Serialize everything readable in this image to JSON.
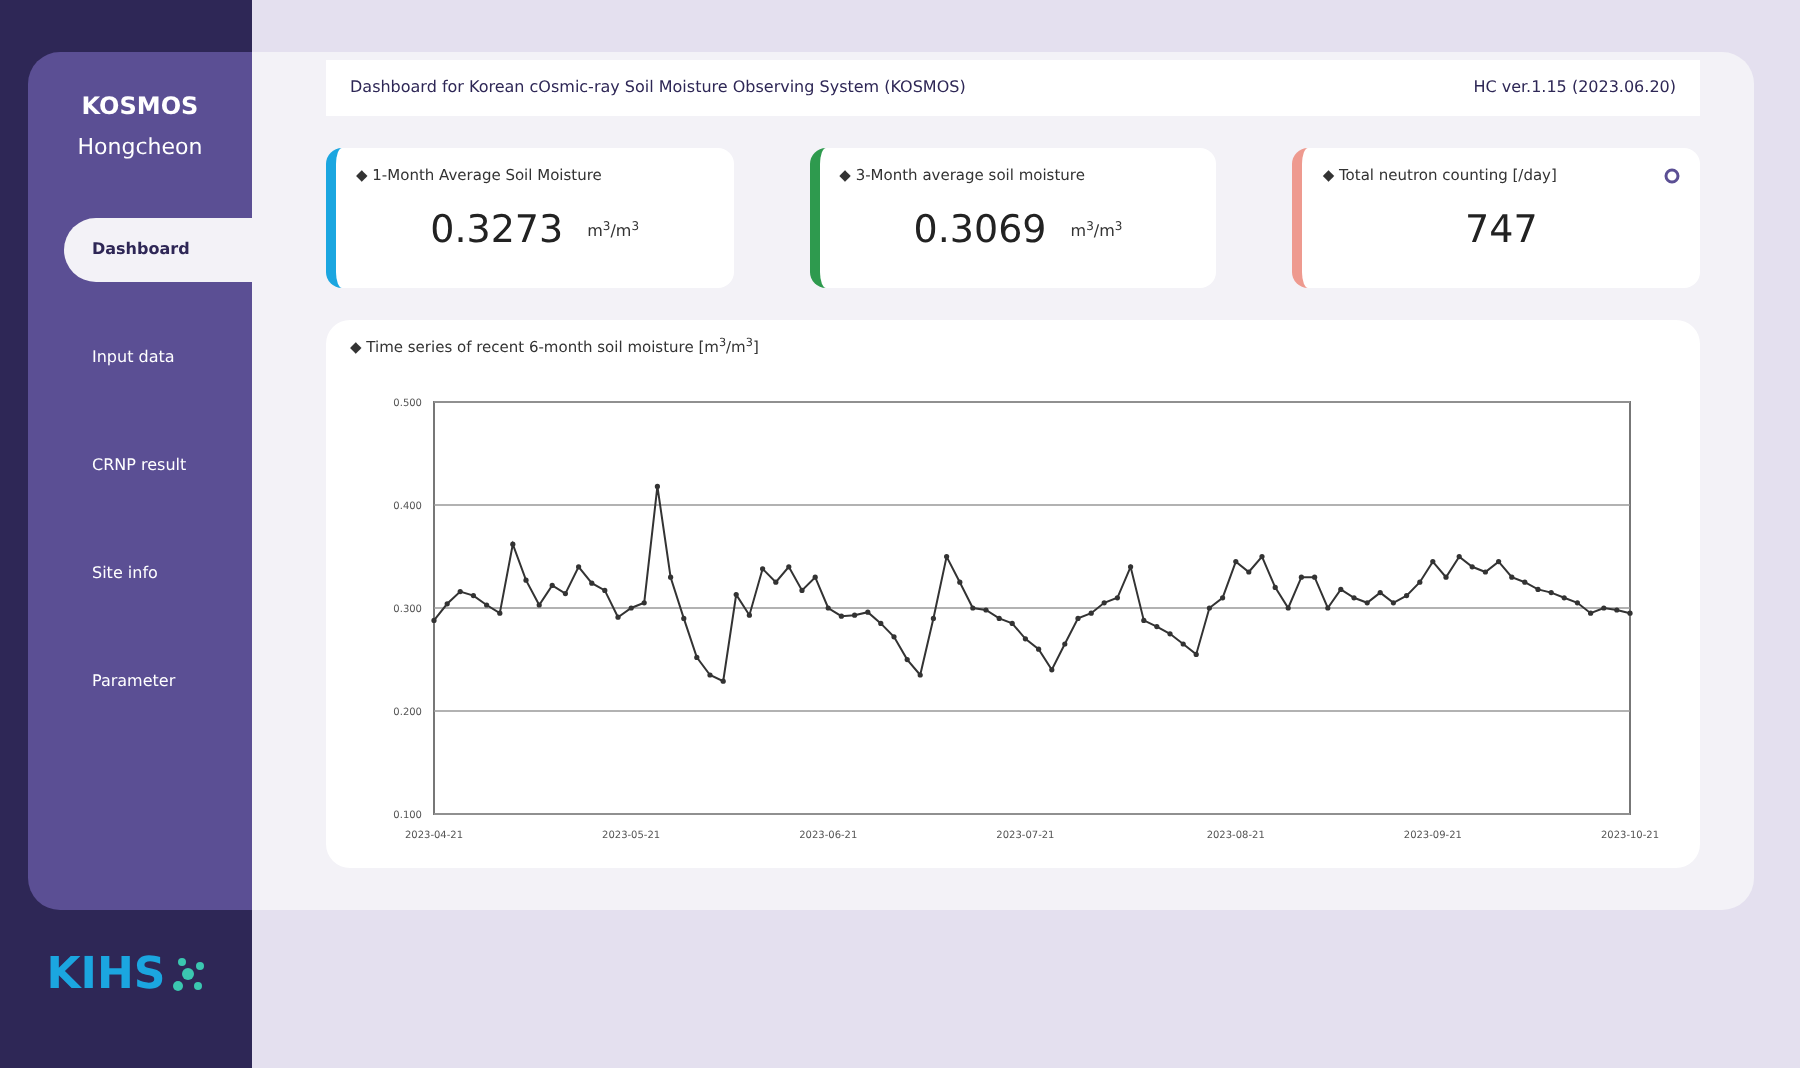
{
  "sidebar": {
    "title": "KOSMOS",
    "site": "Hongcheon",
    "items": [
      {
        "label": "Dashboard",
        "selected": true
      },
      {
        "label": "Input data",
        "selected": false
      },
      {
        "label": "CRNP result",
        "selected": false
      },
      {
        "label": "Site info",
        "selected": false
      },
      {
        "label": "Parameter",
        "selected": false
      }
    ],
    "logo": "KIHS"
  },
  "header": {
    "title": "Dashboard for Korean cOsmic-ray Soil Moisture Observing System (KOSMOS)",
    "version": "HC ver.1.15 (2023.06.20)"
  },
  "cards": [
    {
      "label": "◆ 1-Month Average Soil Moisture",
      "value": "0.3273",
      "unit": "m$^{3}$/m$^{3}$",
      "color": "#1ba6e0"
    },
    {
      "label": "◆ 3-Month average soil moisture",
      "value": "0.3069",
      "unit": "m$^{3}$/m$^{3}$",
      "color": "#2e9a4e"
    },
    {
      "label": "◆ Total neutron counting [/day]",
      "value": "747",
      "color": "#ee9a8f"
    }
  ],
  "chart_panel": {
    "title": "◆ Time series of recent 6-month soil moisture [m$^{3}$/m$^{3}$]",
    "chart_data": {
      "type": "line",
      "categories": [
        "2023-04-21",
        null,
        null,
        null,
        null,
        null,
        null,
        null,
        null,
        null,
        null,
        null,
        null,
        null,
        null,
        "2023-05-21",
        null,
        null,
        null,
        null,
        null,
        null,
        null,
        null,
        null,
        null,
        null,
        null,
        null,
        null,
        "2023-06-21",
        null,
        null,
        null,
        null,
        null,
        null,
        null,
        null,
        null,
        null,
        null,
        null,
        null,
        null,
        "2023-07-21",
        null,
        null,
        null,
        null,
        null,
        null,
        null,
        null,
        null,
        null,
        null,
        null,
        null,
        null,
        null,
        "2023-08-21",
        null,
        null,
        null,
        null,
        null,
        null,
        null,
        null,
        null,
        null,
        null,
        null,
        null,
        null,
        "2023-09-21",
        null,
        null,
        null,
        null,
        null,
        null,
        null,
        null,
        null,
        null,
        null,
        null,
        null,
        null,
        "2023-10-21"
      ],
      "series": [
        {
          "color": "#333333",
          "values": [
            0.288,
            0.304,
            0.316,
            0.312,
            0.303,
            0.295,
            0.362,
            0.327,
            0.303,
            0.322,
            0.314,
            0.34,
            0.324,
            0.317,
            0.291,
            0.3,
            0.305,
            0.418,
            0.33,
            0.29,
            0.252,
            0.235,
            0.229,
            0.313,
            0.293,
            0.338,
            0.325,
            0.34,
            0.317,
            0.33,
            0.3,
            0.292,
            0.293,
            0.296,
            0.285,
            0.272,
            0.25,
            0.235,
            0.29,
            0.35,
            0.325,
            0.3,
            0.298,
            0.29,
            0.285,
            0.27,
            0.26,
            0.24,
            0.265,
            0.29,
            0.295,
            0.305,
            0.31,
            0.34,
            0.288,
            0.282,
            0.275,
            0.265,
            0.255,
            0.3,
            0.31,
            0.345,
            0.335,
            0.35,
            0.32,
            0.3,
            0.33,
            0.33,
            0.3,
            0.318,
            0.31,
            0.305,
            0.315,
            0.305,
            0.312,
            0.325,
            0.345,
            0.33,
            0.35,
            0.34,
            0.335,
            0.345,
            0.33,
            0.325,
            0.318,
            0.315,
            0.31,
            0.305,
            0.295,
            0.3,
            0.298,
            0.295
          ]
        }
      ],
      "grid": true,
      "ylim": [
        0.1,
        0.5
      ],
      "yticks": [
        {
          "value": 0.1,
          "label": "0.100"
        },
        {
          "value": 0.2,
          "label": "0.200"
        },
        {
          "value": 0.3,
          "label": "0.300"
        },
        {
          "value": 0.4,
          "label": "0.400"
        },
        {
          "value": 0.5,
          "label": "0.500"
        }
      ]
    }
  }
}
